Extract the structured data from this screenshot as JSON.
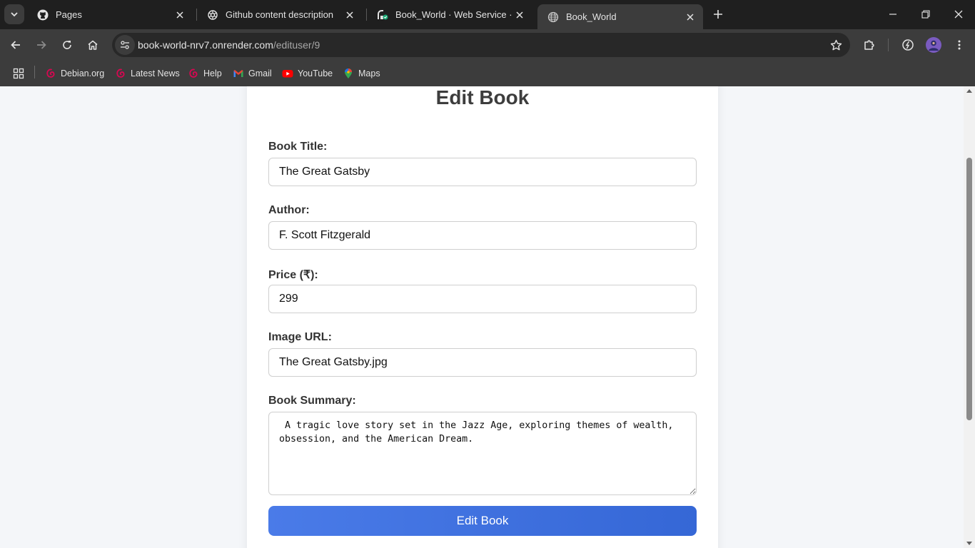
{
  "browser": {
    "tabs": [
      {
        "title": "Pages",
        "favicon": "github-icon"
      },
      {
        "title": "Github content description",
        "favicon": "chatgpt-icon"
      },
      {
        "title": "Book_World · Web Service · Re",
        "favicon": "render-icon"
      },
      {
        "title": "Book_World",
        "favicon": "globe-icon"
      }
    ],
    "active_tab_index": 3,
    "url": {
      "host": "book-world-nrv7.onrender.com",
      "path": "/edituser/9"
    },
    "bookmarks": [
      {
        "label": "Debian.org",
        "icon": "debian-icon"
      },
      {
        "label": "Latest News",
        "icon": "debian-icon"
      },
      {
        "label": "Help",
        "icon": "debian-icon"
      },
      {
        "label": "Gmail",
        "icon": "gmail-icon"
      },
      {
        "label": "YouTube",
        "icon": "youtube-icon"
      },
      {
        "label": "Maps",
        "icon": "maps-icon"
      }
    ]
  },
  "form": {
    "title": "Edit Book",
    "fields": {
      "title": {
        "label": "Book Title:",
        "value": "The Great Gatsby"
      },
      "author": {
        "label": "Author:",
        "value": "F. Scott Fitzgerald"
      },
      "price": {
        "label": "Price (₹):",
        "value": "299"
      },
      "image": {
        "label": "Image URL:",
        "value": "The Great Gatsby.jpg"
      },
      "summary": {
        "label": "Book Summary:",
        "value": " A tragic love story set in the Jazz Age, exploring themes of wealth, obsession, and the American Dream."
      }
    },
    "submit_label": "Edit Book"
  },
  "colors": {
    "button_gradient_start": "#4a7be8",
    "button_gradient_end": "#3567d6",
    "page_background": "#f4f6f9",
    "browser_chrome": "#3c3c3c"
  }
}
